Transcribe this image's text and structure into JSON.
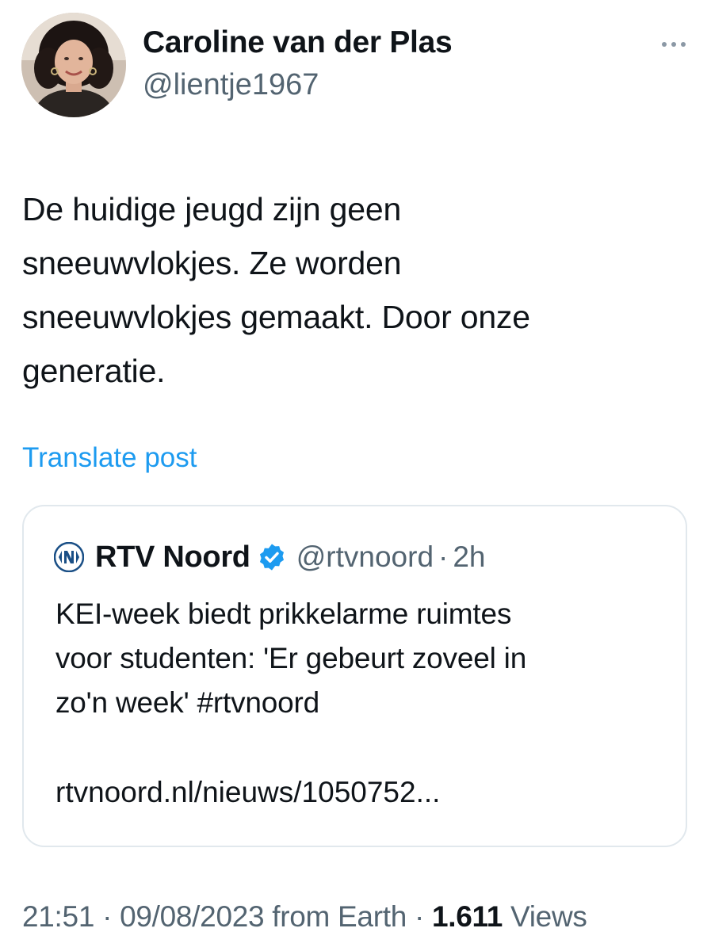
{
  "author": {
    "display_name": "Caroline van der Plas",
    "handle": "@lientje1967",
    "avatar": "profile-photo"
  },
  "post": {
    "text_lines": [
      "De huidige jeugd zijn geen",
      "sneeuwvlokjes. Ze worden",
      "sneeuwvlokjes gemaakt. Door onze",
      "generatie."
    ],
    "translate_label": "Translate post"
  },
  "quoted_post": {
    "name": "RTV Noord",
    "handle": "@rtvnoord",
    "separator": "·",
    "time": "2h",
    "verified": true,
    "text_lines": [
      "KEI-week biedt prikkelarme ruimtes",
      "voor studenten: 'Er gebeurt zoveel in",
      "zo'n week' #rtvnoord"
    ],
    "link": "rtvnoord.nl/nieuws/1050752..."
  },
  "meta": {
    "time": "21:51",
    "separator": "·",
    "date": "09/08/2023",
    "source": "from Earth",
    "views_count": "1.611",
    "views_label": "Views"
  },
  "colors": {
    "accent": "#1d9bf0",
    "text": "#0f1419",
    "secondary": "#536471",
    "border": "#e1e8ed"
  }
}
